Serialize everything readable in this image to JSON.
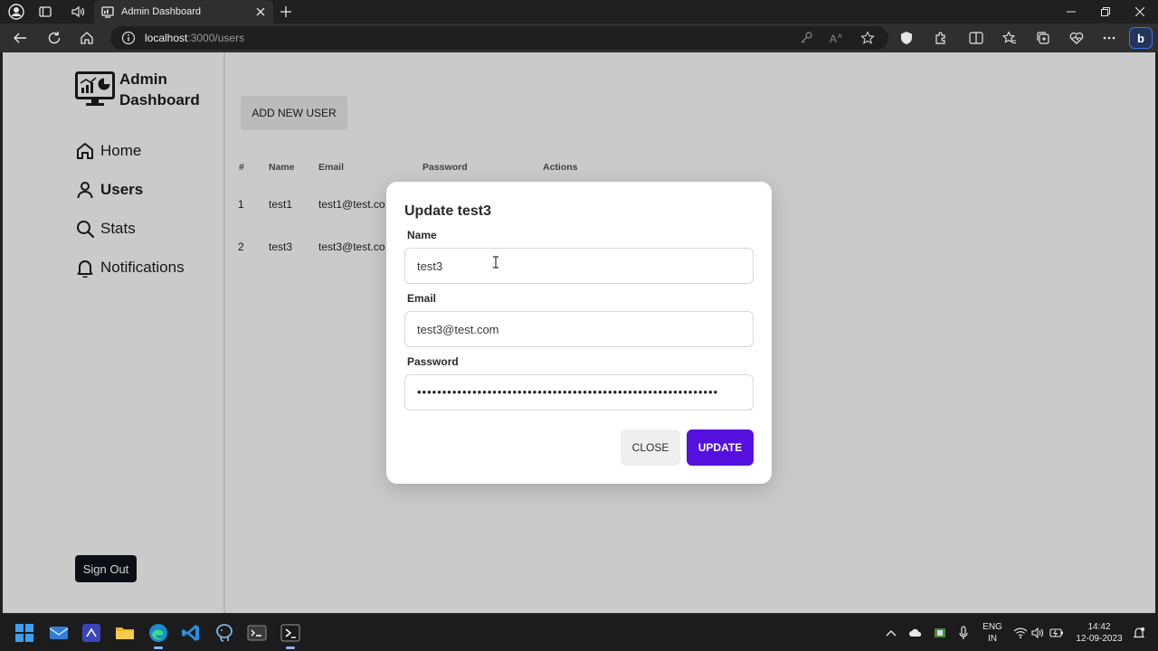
{
  "browser": {
    "tab_title": "Admin Dashboard",
    "url_host": "localhost",
    "url_rest": ":3000/users",
    "accent": "#4673e0"
  },
  "sidebar": {
    "brand": "Admin Dashboard",
    "items": [
      {
        "label": "Home",
        "icon": "home-icon"
      },
      {
        "label": "Users",
        "icon": "user-icon",
        "active": true
      },
      {
        "label": "Stats",
        "icon": "search-icon"
      },
      {
        "label": "Notifications",
        "icon": "bell-icon"
      }
    ],
    "signout_label": "Sign Out"
  },
  "main": {
    "add_user_label": "ADD NEW USER",
    "table": {
      "headers": [
        "#",
        "Name",
        "Email",
        "Password",
        "Actions"
      ],
      "rows": [
        [
          "1",
          "test1",
          "test1@test.co"
        ],
        [
          "2",
          "test3",
          "test3@test.co"
        ]
      ]
    }
  },
  "modal": {
    "title": "Update test3",
    "name_label": "Name",
    "name_value": "test3",
    "email_label": "Email",
    "email_value": "test3@test.com",
    "password_label": "Password",
    "password_value": "••••••••••••••••••••••••••••••••••••••••••••••••••••••••••••",
    "close_label": "CLOSE",
    "update_label": "UPDATE",
    "update_color": "#5510e0"
  },
  "taskbar": {
    "lang_line1": "ENG",
    "lang_line2": "IN",
    "time": "14:42",
    "date": "12-09-2023"
  }
}
